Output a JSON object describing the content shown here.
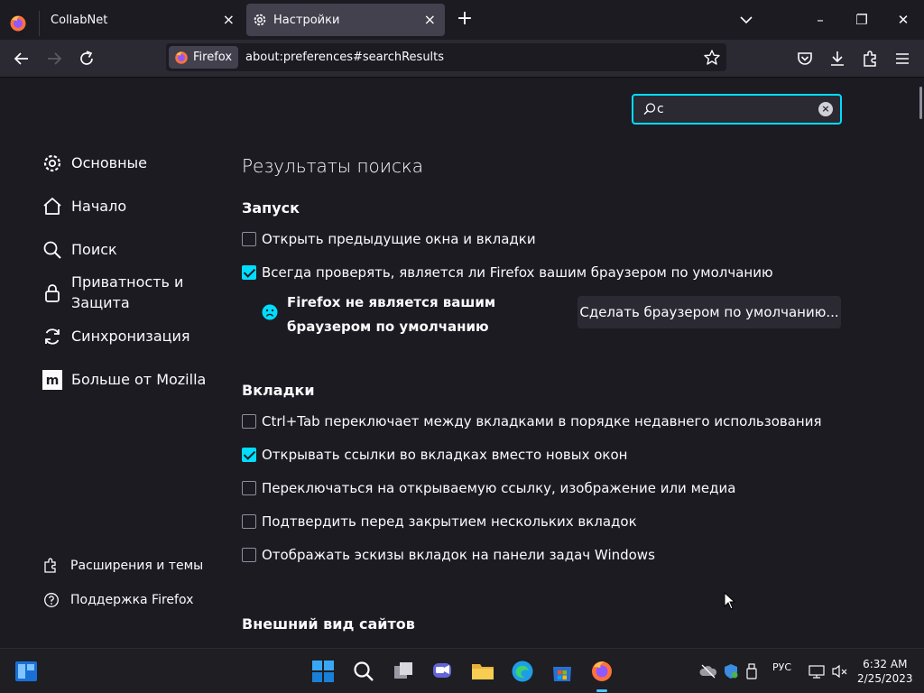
{
  "tabs": [
    {
      "title": "CollabNet",
      "close": "×"
    },
    {
      "title": "Настройки",
      "close": "×"
    }
  ],
  "new_tab": "+",
  "window_controls": {
    "minimize": "–",
    "maximize": "❐",
    "close": "✕"
  },
  "urlbar": {
    "identity_label": "Firefox",
    "url": "about:preferences#searchResults"
  },
  "search": {
    "value": "с"
  },
  "sidebar": {
    "items": [
      {
        "label": "Основные",
        "icon": "gear-icon"
      },
      {
        "label": "Начало",
        "icon": "home-icon"
      },
      {
        "label": "Поиск",
        "icon": "search-icon"
      },
      {
        "label": "Приватность и Защита",
        "icon": "lock-icon"
      },
      {
        "label": "Синхронизация",
        "icon": "sync-icon"
      },
      {
        "label": "Больше от Mozilla",
        "icon": "mozilla-icon"
      }
    ],
    "footer": [
      {
        "label": "Расширения и темы",
        "icon": "puzzle-icon"
      },
      {
        "label": "Поддержка Firefox",
        "icon": "help-icon"
      }
    ]
  },
  "main": {
    "title": "Результаты поиска",
    "startup": {
      "heading": "Запуск",
      "restore_session": {
        "label": "Открыть предыдущие окна и вкладки",
        "checked": false
      },
      "check_default": {
        "label": "Всегда проверять, является ли Firefox вашим браузером по умолчанию",
        "checked": true
      },
      "not_default_text": "Firefox не является вашим браузером по умолчанию",
      "make_default_button": "Сделать браузером по умолчанию..."
    },
    "tabs_section": {
      "heading": "Вкладки",
      "options": [
        {
          "label": "Ctrl+Tab переключает между вкладками в порядке недавнего использования",
          "checked": false
        },
        {
          "label": "Открывать ссылки во вкладках вместо новых окон",
          "checked": true
        },
        {
          "label": "Переключаться на открываемую ссылку, изображение или медиа",
          "checked": false
        },
        {
          "label": "Подтвердить перед закрытием нескольких вкладок",
          "checked": false
        },
        {
          "label": "Отображать эскизы вкладок на панели задач Windows",
          "checked": false
        }
      ]
    },
    "appearance": {
      "heading": "Внешний вид сайтов"
    }
  },
  "taskbar": {
    "language": "РУС",
    "time": "6:32 AM",
    "date": "2/25/2023"
  },
  "colors": {
    "accent": "#00ddff",
    "background": "#1c1b22",
    "highlight": "#0a3a8c"
  }
}
